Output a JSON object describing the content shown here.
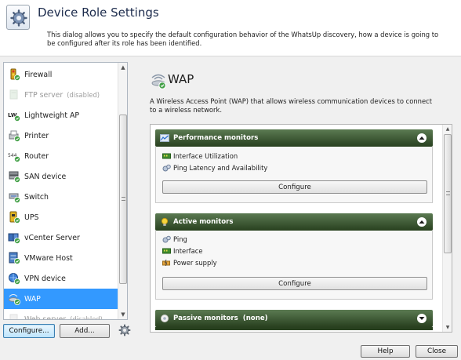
{
  "header": {
    "title": "Device Role Settings",
    "description": "This dialog allows you to specify the default configuration behavior of the WhatsUp discovery, how a device is going to be configured after its role has been identified."
  },
  "roles": [
    {
      "label": "Firewall",
      "icon": "firewall-icon",
      "disabled": false,
      "suffix": ""
    },
    {
      "label": "FTP server",
      "icon": "ftp-server-icon",
      "disabled": true,
      "suffix": "(disabled)"
    },
    {
      "label": "Lightweight AP",
      "icon": "lightweight-ap-icon",
      "disabled": false,
      "suffix": ""
    },
    {
      "label": "Printer",
      "icon": "printer-icon",
      "disabled": false,
      "suffix": ""
    },
    {
      "label": "Router",
      "icon": "router-icon",
      "disabled": false,
      "suffix": ""
    },
    {
      "label": "SAN device",
      "icon": "san-device-icon",
      "disabled": false,
      "suffix": ""
    },
    {
      "label": "Switch",
      "icon": "switch-icon",
      "disabled": false,
      "suffix": ""
    },
    {
      "label": "UPS",
      "icon": "ups-icon",
      "disabled": false,
      "suffix": ""
    },
    {
      "label": "vCenter Server",
      "icon": "vcenter-server-icon",
      "disabled": false,
      "suffix": ""
    },
    {
      "label": "VMware Host",
      "icon": "vmware-host-icon",
      "disabled": false,
      "suffix": ""
    },
    {
      "label": "VPN device",
      "icon": "vpn-device-icon",
      "disabled": false,
      "suffix": ""
    },
    {
      "label": "WAP",
      "icon": "wap-icon",
      "disabled": false,
      "suffix": "",
      "selected": true
    },
    {
      "label": "Web server",
      "icon": "web-server-icon",
      "disabled": true,
      "suffix": "(disabled)"
    }
  ],
  "left_buttons": {
    "configure": "Configure...",
    "add": "Add..."
  },
  "detail": {
    "role_name": "WAP",
    "description": "A Wireless Access Point (WAP) that allows wireless communication devices to connect to a wireless network.",
    "sections": [
      {
        "title": "Performance monitors",
        "suffix": "",
        "expanded": true,
        "icon": "performance-monitor-icon",
        "monitors": [
          {
            "label": "Interface Utilization",
            "icon": "interface-icon"
          },
          {
            "label": "Ping Latency and Availability",
            "icon": "ping-icon"
          }
        ],
        "button": "Configure"
      },
      {
        "title": "Active monitors",
        "suffix": "",
        "expanded": true,
        "icon": "active-monitor-bulb-icon",
        "monitors": [
          {
            "label": "Ping",
            "icon": "ping-icon"
          },
          {
            "label": "Interface",
            "icon": "interface-icon"
          },
          {
            "label": "Power supply",
            "icon": "power-supply-icon"
          }
        ],
        "button": "Configure"
      },
      {
        "title": "Passive monitors",
        "suffix": "(none)",
        "expanded": false,
        "icon": "passive-monitor-icon",
        "monitors": [],
        "button": ""
      }
    ]
  },
  "footer": {
    "help": "Help",
    "close": "Close"
  },
  "colors": {
    "selection": "#3399ff",
    "section_header_top": "#5b7a52",
    "section_header_bottom": "#28401f",
    "title_color": "#1d2c4d"
  }
}
